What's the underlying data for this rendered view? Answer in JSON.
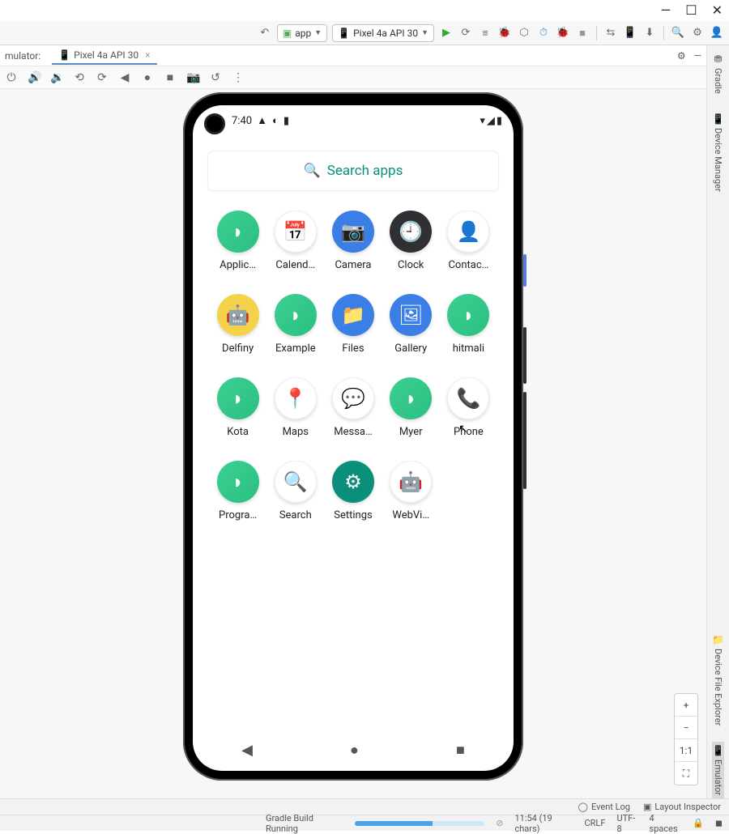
{
  "window": {
    "minimize": "—",
    "maximize": "☐",
    "close": "✕"
  },
  "toolbar": {
    "app_dropdown": "app",
    "device_dropdown": "Pixel 4a API 30"
  },
  "emulator_row": {
    "label": "mulator:",
    "tab": "Pixel 4a API 30"
  },
  "phone": {
    "time": "7:40",
    "search_placeholder": "Search apps",
    "apps": [
      {
        "label": "Applic…",
        "bg": "ic-green",
        "glyph": "◗"
      },
      {
        "label": "Calend…",
        "bg": "ic-white",
        "glyph": "📅"
      },
      {
        "label": "Camera",
        "bg": "ic-blue",
        "glyph": "📷"
      },
      {
        "label": "Clock",
        "bg": "ic-dark",
        "glyph": "🕘"
      },
      {
        "label": "Contac…",
        "bg": "ic-white",
        "glyph": "👤"
      },
      {
        "label": "Delfiny",
        "bg": "ic-yellow",
        "glyph": "🤖"
      },
      {
        "label": "Example",
        "bg": "ic-green",
        "glyph": "◗"
      },
      {
        "label": "Files",
        "bg": "ic-blue",
        "glyph": "📁"
      },
      {
        "label": "Gallery",
        "bg": "ic-blue",
        "glyph": "🖼"
      },
      {
        "label": "hitmali",
        "bg": "ic-green",
        "glyph": "◗"
      },
      {
        "label": "Kota",
        "bg": "ic-green",
        "glyph": "◗"
      },
      {
        "label": "Maps",
        "bg": "ic-white",
        "glyph": "📍"
      },
      {
        "label": "Messa…",
        "bg": "ic-white",
        "glyph": "💬"
      },
      {
        "label": "Myer",
        "bg": "ic-green",
        "glyph": "◗"
      },
      {
        "label": "Phone",
        "bg": "ic-white",
        "glyph": "📞"
      },
      {
        "label": "Progra…",
        "bg": "ic-green",
        "glyph": "◗"
      },
      {
        "label": "Search",
        "bg": "ic-white",
        "glyph": "🔍"
      },
      {
        "label": "Settings",
        "bg": "ic-teal",
        "glyph": "⚙"
      },
      {
        "label": "WebVi…",
        "bg": "ic-white",
        "glyph": "🤖"
      }
    ]
  },
  "right_panel": {
    "gradle": "Gradle",
    "device_manager": "Device Manager",
    "device_file_explorer": "Device File Explorer",
    "emulator": "Emulator"
  },
  "zoom": {
    "plus": "+",
    "minus": "−",
    "onetoone": "1:1",
    "fit": "⛶"
  },
  "bottom": {
    "event_log": "Event Log",
    "layout_inspector": "Layout Inspector",
    "gradle_running": "Gradle Build Running",
    "cursor_pos": "11:54 (19 chars)",
    "line_ending": "CRLF",
    "encoding": "UTF-8",
    "indent": "4 spaces"
  }
}
